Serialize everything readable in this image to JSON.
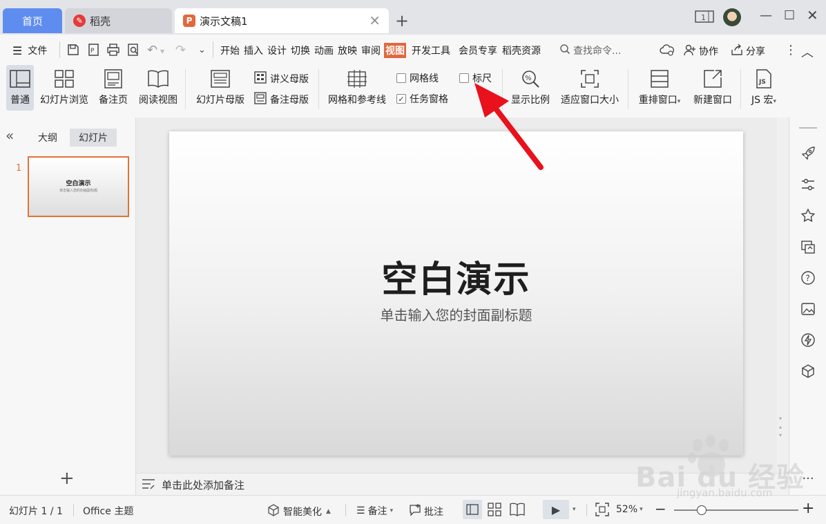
{
  "tabs": {
    "home": "首页",
    "daoke": "稻壳",
    "doc": "演示文稿1",
    "doc_icon_letter": "P"
  },
  "menu": {
    "file": "文件",
    "items": [
      "开始",
      "插入",
      "设计",
      "切换",
      "动画",
      "放映",
      "审阅",
      "视图",
      "开发工具",
      "会员专享",
      "稻壳资源"
    ],
    "active": "视图",
    "search": "查找命令...",
    "collab": "协作",
    "share": "分享"
  },
  "ribbon": {
    "normal": "普通",
    "slide_browse": "幻灯片浏览",
    "notes_page": "备注页",
    "reading_view": "阅读视图",
    "slide_master": "幻灯片母版",
    "handout_master": "讲义母版",
    "notes_master": "备注母版",
    "grid_guides": "网格和参考线",
    "gridlines": "网格线",
    "ruler": "标尺",
    "task_pane": "任务窗格",
    "zoom": "显示比例",
    "fit_window": "适应窗口大小",
    "arrange": "重排窗口",
    "new_window": "新建窗口",
    "js_macro": "JS 宏",
    "gridlines_checked": false,
    "ruler_checked": false,
    "task_pane_checked": true
  },
  "leftpanel": {
    "tab_outline": "大纲",
    "tab_slides": "幻灯片",
    "slide_number": "1",
    "thumb_title": "空白演示",
    "thumb_subtitle": "单击输入您的封面副标题"
  },
  "slide": {
    "title": "空白演示",
    "subtitle": "单击输入您的封面副标题"
  },
  "notes": {
    "placeholder": "单击此处添加备注"
  },
  "status": {
    "slide_count": "幻灯片 1 / 1",
    "theme": "Office 主题",
    "beautify": "智能美化",
    "notes": "备注",
    "comments": "批注",
    "zoom": "52%",
    "zoom_fraction": 0.5
  },
  "watermark": {
    "brand": "Bai du 经验",
    "url": "jingyan.baidu.com"
  },
  "colors": {
    "accent": "#e2673f",
    "home_tab": "#5f8cef",
    "arrow": "#e8111c",
    "thumb_border": "#e07335"
  }
}
